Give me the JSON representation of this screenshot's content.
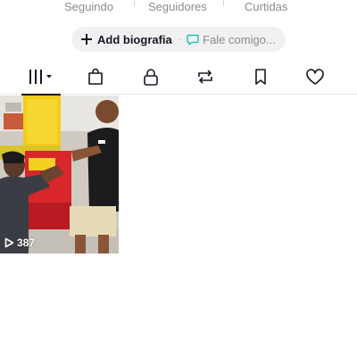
{
  "profile_stats": [
    {
      "label": "Seguindo"
    },
    {
      "label": "Seguidores"
    },
    {
      "label": "Curtidas"
    }
  ],
  "bio_bar": {
    "add_bio_label": "Add biografia",
    "separator": "·",
    "contact_label": "Fale comigo..."
  },
  "tabs": [
    {
      "name": "videos-grid-icon",
      "active": true
    },
    {
      "name": "shop-bag-icon",
      "active": false
    },
    {
      "name": "private-lock-icon",
      "active": false
    },
    {
      "name": "reposts-icon",
      "active": false
    },
    {
      "name": "favorites-bookmark-icon",
      "active": false
    },
    {
      "name": "liked-heart-icon",
      "active": false
    }
  ],
  "videos": [
    {
      "views": "387",
      "thumbnail": "two-people-in-store-photo"
    }
  ],
  "colors": {
    "text": "#161823",
    "muted": "#8a8b91",
    "chat_accent": "#25c4b6",
    "pill_bg": "#f1f1f2"
  }
}
